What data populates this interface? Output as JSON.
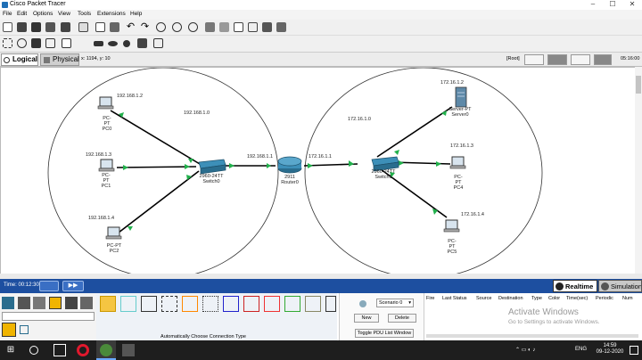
{
  "title_bar": {
    "title": "Cisco Packet Tracer"
  },
  "menu": [
    "File",
    "Edit",
    "Options",
    "View",
    "Tools",
    "Extensions",
    "Help"
  ],
  "tabs": {
    "logical": "Logical",
    "physical": "Physical",
    "coords": "x: 1194, y: 10",
    "root": "[Root]",
    "time": "05:16:00"
  },
  "network": {
    "network_labels": [
      "192.168.1.0",
      "172.16.1.0"
    ],
    "ip_labels": [
      "192.168.1.2",
      "192.168.1.3",
      "192.168.1.4",
      "192.168.1.1",
      "172.16.1.1",
      "172.16.1.2",
      "172.16.1.3",
      "172.16.1.4"
    ],
    "devices": {
      "pc0": [
        "PC-PT",
        "PC0"
      ],
      "pc1": [
        "PC-PT",
        "PC1"
      ],
      "pc2": [
        "PC-PT",
        "PC2"
      ],
      "switch0": [
        "2960-24TT",
        "Switch0"
      ],
      "router0": [
        "2911",
        "Router0"
      ],
      "switch1": [
        "2960-24TT",
        "Switch1"
      ],
      "server0": [
        "Server-PT",
        "Server0"
      ],
      "pc4": [
        "PC-PT",
        "PC4"
      ],
      "pc5": [
        "PC-PT",
        "PC5"
      ]
    }
  },
  "statusbar": {
    "time": "Time: 00:12:30",
    "realtime": "Realtime",
    "simulation": "Simulation"
  },
  "bottom": {
    "connection_type": "Automatically Choose Connection Type",
    "scenario": "Scenario 0",
    "new_label": "New",
    "delete_label": "Delete",
    "toggle_label": "Toggle PDU List Window",
    "pdu_columns": [
      "Fire",
      "Last Status",
      "Source",
      "Destination",
      "Type",
      "Color",
      "Time(sec)",
      "Periodic",
      "Num"
    ],
    "watermark_title": "Activate Windows",
    "watermark_sub": "Go to Settings to activate Windows."
  },
  "taskbar": {
    "lang": "ENG",
    "time": "14:59",
    "date": "09-12-2020"
  },
  "colors": {
    "status_blue": "#1d4fa0",
    "link_dot": "#22b14c"
  }
}
